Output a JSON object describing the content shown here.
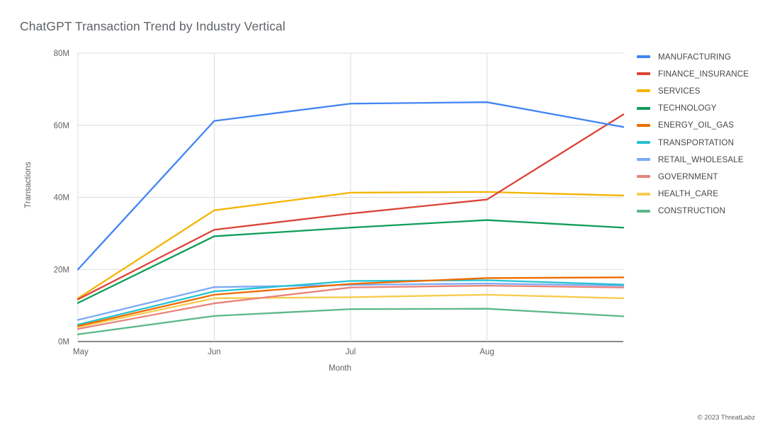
{
  "title": "ChatGPT Transaction Trend by Industry Vertical",
  "footer": "© 2023 ThreatLabz",
  "axis": {
    "x_title": "Month",
    "y_title": "Transactions"
  },
  "legend": {
    "items": [
      {
        "label": "MANUFACTURING",
        "color": "#4285f4"
      },
      {
        "label": "FINANCE_INSURANCE",
        "color": "#db4437"
      },
      {
        "label": "SERVICES",
        "color": "#f4b400"
      },
      {
        "label": "TECHNOLOGY",
        "color": "#0f9d58"
      },
      {
        "label": "ENERGY_OIL_GAS",
        "color": "#ef6c00"
      },
      {
        "label": "TRANSPORTATION",
        "color": "#25c3d0"
      },
      {
        "label": "RETAIL_WHOLESALE",
        "color": "#7baaf7"
      },
      {
        "label": "GOVERNMENT",
        "color": "#e8837b"
      },
      {
        "label": "HEALTH_CARE",
        "color": "#f7cb4d"
      },
      {
        "label": "CONSTRUCTION",
        "color": "#5cb88a"
      }
    ]
  },
  "chart_data": {
    "type": "line",
    "title": "ChatGPT Transaction Trend by Industry Vertical",
    "xlabel": "Month",
    "ylabel": "Transactions",
    "x": [
      "May",
      "Jun",
      "Jul",
      "Aug",
      ""
    ],
    "x_tick_labels": [
      "May",
      "Jun",
      "Jul",
      "Aug"
    ],
    "y_tick_labels": [
      "0M",
      "20M",
      "40M",
      "60M",
      "80M"
    ],
    "y_ticks": [
      0,
      20000000,
      40000000,
      60000000,
      80000000
    ],
    "ylim": [
      0,
      80000000
    ],
    "y_unit": "M",
    "grid": true,
    "legend_position": "right",
    "series": [
      {
        "name": "MANUFACTURING",
        "color": "#4285f4",
        "values": [
          20000000,
          61200000,
          66000000,
          66400000,
          59500000
        ]
      },
      {
        "name": "FINANCE_INSURANCE",
        "color": "#db4437",
        "values": [
          11700000,
          31000000,
          35500000,
          39400000,
          63000000
        ]
      },
      {
        "name": "SERVICES",
        "color": "#f4b400",
        "values": [
          12000000,
          36400000,
          41300000,
          41500000,
          40500000
        ]
      },
      {
        "name": "TECHNOLOGY",
        "color": "#0f9d58",
        "values": [
          10700000,
          29200000,
          31600000,
          33700000,
          31600000
        ]
      },
      {
        "name": "ENERGY_OIL_GAS",
        "color": "#ef6c00",
        "values": [
          4300000,
          13000000,
          16000000,
          17600000,
          17800000
        ]
      },
      {
        "name": "TRANSPORTATION",
        "color": "#25c3d0",
        "values": [
          4700000,
          13900000,
          16800000,
          17000000,
          15800000
        ]
      },
      {
        "name": "RETAIL_WHOLESALE",
        "color": "#7baaf7",
        "values": [
          6000000,
          15100000,
          15700000,
          16100000,
          15500000
        ]
      },
      {
        "name": "GOVERNMENT",
        "color": "#e8837b",
        "values": [
          3500000,
          10600000,
          15000000,
          15500000,
          15000000
        ]
      },
      {
        "name": "HEALTH_CARE",
        "color": "#f7cb4d",
        "values": [
          4000000,
          12000000,
          12300000,
          13000000,
          12000000
        ]
      },
      {
        "name": "CONSTRUCTION",
        "color": "#5cb88a",
        "values": [
          2000000,
          7100000,
          9000000,
          9100000,
          7000000
        ]
      }
    ]
  }
}
